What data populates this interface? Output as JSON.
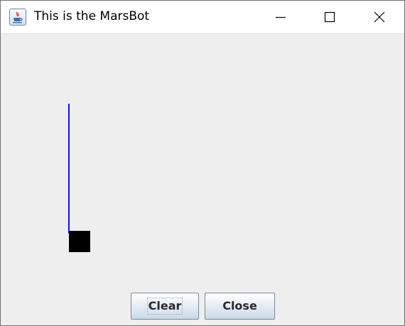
{
  "window": {
    "title": "This is the MarsBot",
    "icon": "java-coffee-cup-icon",
    "controls": {
      "minimize": "minimize-icon",
      "maximize": "maximize-icon",
      "close": "close-icon"
    }
  },
  "canvas": {
    "path_color": "#1010f0",
    "robot_color": "#000000",
    "background": "#eeeeee"
  },
  "buttons": {
    "clear_label": "Clear",
    "close_label": "Close"
  }
}
